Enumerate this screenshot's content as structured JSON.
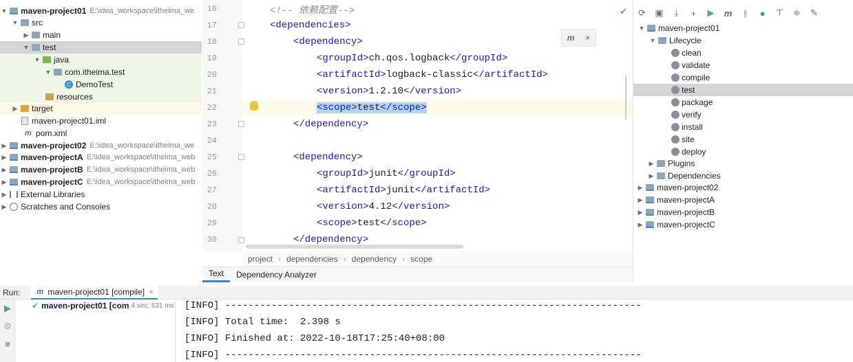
{
  "project_tree": {
    "items": [
      {
        "label": "maven-project01",
        "path": "E:\\idea_workspace\\itheima_we",
        "bold": true
      },
      {
        "label": "src"
      },
      {
        "label": "main"
      },
      {
        "label": "test"
      },
      {
        "label": "java"
      },
      {
        "label": "com.itheima.test"
      },
      {
        "label": "DemoTest"
      },
      {
        "label": "resources"
      },
      {
        "label": "target"
      },
      {
        "label": "maven-project01.iml"
      },
      {
        "label": "pom.xml"
      },
      {
        "label": "maven-project02",
        "path": "E:\\idea_workspace\\itheima_we",
        "bold": true
      },
      {
        "label": "maven-projectA",
        "path": "E:\\idea_workspace\\itheima_web",
        "bold": true
      },
      {
        "label": "maven-projectB",
        "path": "E:\\idea_workspace\\itheima_web",
        "bold": true
      },
      {
        "label": "maven-projectC",
        "path": "E:\\idea_workspace\\itheima_web",
        "bold": true
      },
      {
        "label": "External Libraries"
      },
      {
        "label": "Scratches and Consoles"
      }
    ]
  },
  "editor": {
    "line_numbers": [
      "16",
      "17",
      "18",
      "19",
      "20",
      "21",
      "22",
      "23",
      "24",
      "25",
      "26",
      "27",
      "28",
      "29",
      "30"
    ],
    "comment_text": "<!-- 依赖配置-->",
    "lines": {
      "l17": {
        "indent": "  ",
        "open": "<dependencies>"
      },
      "l18": {
        "indent": "    ",
        "open": "<dependency>"
      },
      "l19": {
        "indent": "      ",
        "open": "<groupId>",
        "val": "ch.qos.logback",
        "close": "</groupId>"
      },
      "l20": {
        "indent": "      ",
        "open": "<artifactId>",
        "val": "logback-classic",
        "close": "</artifactId>"
      },
      "l21": {
        "indent": "      ",
        "open": "<version>",
        "val": "1.2.10",
        "close": "</version>"
      },
      "l22": {
        "indent": "      ",
        "open": "<scope>",
        "val": "test",
        "close": "</scope>"
      },
      "l23": {
        "indent": "    ",
        "close": "</dependency>"
      },
      "l25": {
        "indent": "    ",
        "open": "<dependency>"
      },
      "l26": {
        "indent": "      ",
        "open": "<groupId>",
        "val": "junit",
        "close": "</groupId>"
      },
      "l27": {
        "indent": "      ",
        "open": "<artifactId>",
        "val": "junit",
        "close": "</artifactId>"
      },
      "l28": {
        "indent": "      ",
        "open": "<version>",
        "val": "4.12",
        "close": "</version>"
      },
      "l29": {
        "indent": "      ",
        "open": "<scope>",
        "val": "test",
        "close": "</scope>"
      },
      "l30": {
        "indent": "    ",
        "close": "</dependency>"
      }
    },
    "breadcrumbs": [
      "project",
      "dependencies",
      "dependency",
      "scope"
    ],
    "tabs": [
      "Text",
      "Dependency Analyzer"
    ],
    "popup_icon": "maven-reload-icon",
    "popup_close": "×"
  },
  "maven_panel": {
    "root": "maven-project01",
    "lifecycle_label": "Lifecycle",
    "lifecycle": [
      "clean",
      "validate",
      "compile",
      "test",
      "package",
      "verify",
      "install",
      "site",
      "deploy"
    ],
    "plugins_label": "Plugins",
    "dependencies_label": "Dependencies",
    "other_projects": [
      "maven-project02",
      "maven-projectA",
      "maven-projectB",
      "maven-projectC"
    ]
  },
  "run": {
    "label": "Run:",
    "tab_label": "maven-project01 [compile]",
    "tab_close": "×",
    "tree_item": "maven-project01 [com",
    "duration": "4 sec, 631 ms",
    "console": [
      "[INFO] ------------------------------------------------------------------------",
      "[INFO] Total time:  2.398 s",
      "[INFO] Finished at: 2022-10-18T17:25:40+08:00",
      "[INFO] ------------------------------------------------------------------------"
    ]
  }
}
